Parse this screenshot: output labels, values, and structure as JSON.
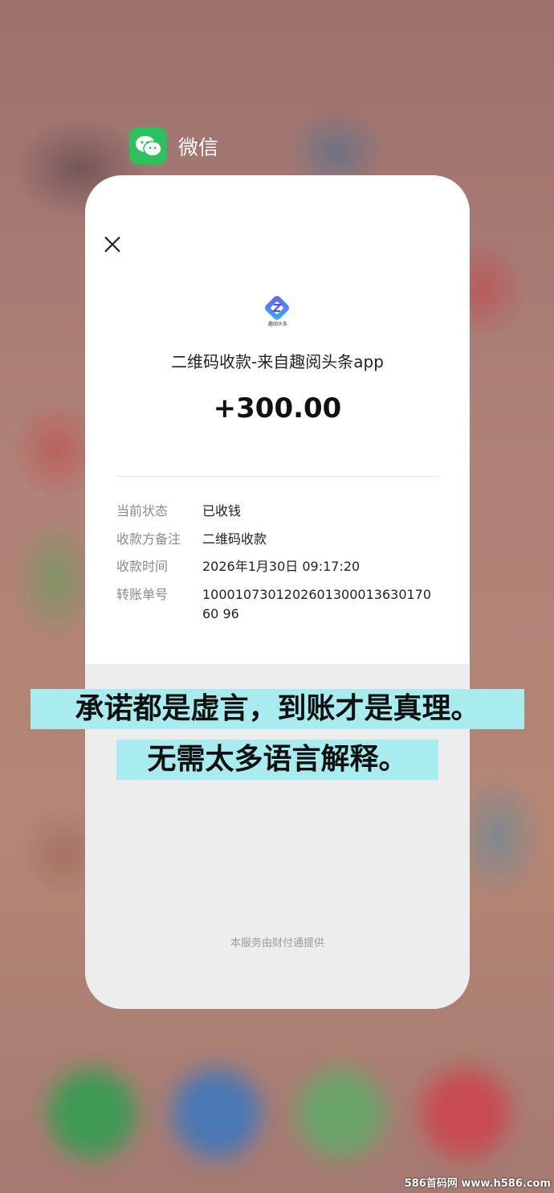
{
  "app": {
    "name": "微信"
  },
  "receipt": {
    "title": "二维码收款-来自趣阅头条app",
    "logo_caption": "趣阅头条",
    "amount": "+300.00",
    "details": [
      {
        "label": "当前状态",
        "value": "已收钱"
      },
      {
        "label": "收款方备注",
        "value": "二维码收款"
      },
      {
        "label": "收款时间",
        "value": "2026年1月30日 09:17:20"
      },
      {
        "label": "转账单号",
        "value": "100010730120260130001363017060 96"
      }
    ],
    "footer": "本服务由财付通提供"
  },
  "captions": {
    "line1": "承诺都是虚言，到账才是真理。",
    "line2": "无需太多语言解释。"
  },
  "watermark": "586首码网 www.h586.com",
  "colors": {
    "wechat_green": "#2dc15d",
    "caption_bg": "#a9ecef",
    "card_bg": "#ffffff",
    "card_footer_bg": "#ededed"
  },
  "icons": [
    "wechat-icon",
    "close-icon",
    "merchant-logo"
  ]
}
